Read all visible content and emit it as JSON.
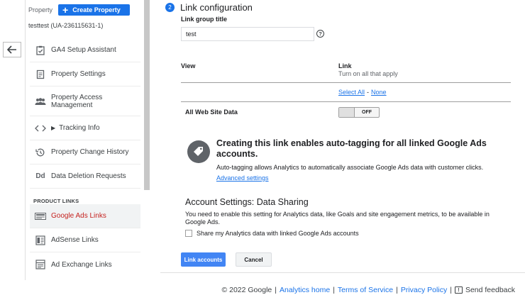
{
  "sidebar": {
    "property_label": "Property",
    "create_property_label": "Create Property",
    "account_id": "testtest (UA-236115631-1)",
    "items": [
      {
        "label": "GA4 Setup Assistant",
        "icon": "checklist-icon"
      },
      {
        "label": "Property Settings",
        "icon": "document-icon"
      },
      {
        "label": "Property Access Management",
        "icon": "people-icon"
      },
      {
        "label": "Tracking Info",
        "icon": "code-icon"
      },
      {
        "label": "Property Change History",
        "icon": "history-icon"
      },
      {
        "label": "Data Deletion Requests",
        "icon": "dd-icon"
      }
    ],
    "product_links_header": "PRODUCT LINKS",
    "product_links": [
      {
        "label": "Google Ads Links",
        "icon": "ads-icon",
        "active": true
      },
      {
        "label": "AdSense Links",
        "icon": "adsense-icon"
      },
      {
        "label": "Ad Exchange Links",
        "icon": "adexchange-icon"
      }
    ]
  },
  "main": {
    "step_number": "2",
    "step_title": "Link configuration",
    "group_title_label": "Link group title",
    "group_title_value": "test",
    "help_glyph": "?",
    "table": {
      "col_view": "View",
      "col_link": "Link",
      "col_link_sub": "Turn on all that apply",
      "select_all": "Select All",
      "separator": "-",
      "none": "None",
      "row_label": "All Web Site Data",
      "toggle_state": "OFF"
    },
    "autotag": {
      "title": "Creating this link enables auto-tagging for all linked Google Ads accounts.",
      "text": "Auto-tagging allows Analytics to automatically associate Google Ads data with customer clicks.",
      "link": "Advanced settings"
    },
    "account_settings": {
      "title": "Account Settings: Data Sharing",
      "text": "You need to enable this setting for Analytics data, like Goals and site engagement metrics, to be available in Google Ads.",
      "checkbox_label": "Share my Analytics data with linked Google Ads accounts",
      "checked": false
    },
    "buttons": {
      "link_accounts": "Link accounts",
      "cancel": "Cancel"
    }
  },
  "footer": {
    "copyright": "© 2022 Google",
    "sep": "|",
    "links": [
      "Analytics home",
      "Terms of Service",
      "Privacy Policy"
    ],
    "send_feedback": "Send feedback"
  },
  "colors": {
    "accent": "#1a73e8",
    "active_nav": "#c5221f",
    "primary_button": "#4285f4"
  }
}
